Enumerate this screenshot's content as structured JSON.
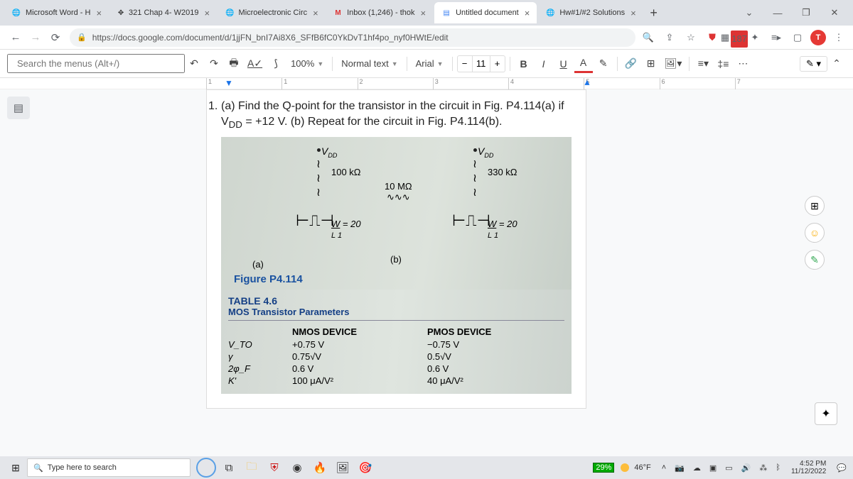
{
  "browser": {
    "tabs": [
      {
        "label": "Microsoft Word - H"
      },
      {
        "label": "321 Chap 4- W2019"
      },
      {
        "label": "Microelectronic Circ"
      },
      {
        "label": "Inbox (1,246) - thok"
      },
      {
        "label": "Untitled document"
      },
      {
        "label": "Hw#1/#2 Solutions"
      }
    ],
    "url": "https://docs.google.com/document/d/1jjFN_bnI7Ai8X6_SFfB6fC0YkDvT1hf4po_nyf0HWtE/edit",
    "ext_badge": "187",
    "avatar_letter": "T"
  },
  "docs": {
    "search_placeholder": "Search the menus (Alt+/)",
    "zoom": "100%",
    "style": "Normal text",
    "font": "Arial",
    "font_size": "11",
    "ruler": [
      "1",
      "1",
      "2",
      "3",
      "4",
      "5",
      "6",
      "7"
    ]
  },
  "content": {
    "problem_num": "1.",
    "problem_text_a": "(a) Find the Q-point for the transistor in the circuit in Fig. P4.114(a) if V",
    "problem_text_b": " = +12 V. (b) Repeat for the circuit in Fig. P4.114(b).",
    "vdd": "V",
    "vdd_sub": "DD",
    "res_a": "100 kΩ",
    "res_b": "330 kΩ",
    "ten_mohm": "10 MΩ",
    "wl": "W",
    "wl_eq": " = 20",
    "wl_den": "L       1",
    "label_a": "(a)",
    "label_b": "(b)",
    "fig_caption": "Figure P4.114",
    "table_title": "TABLE 4.6",
    "table_sub": "MOS Transistor Parameters",
    "col_nmos": "NMOS DEVICE",
    "col_pmos": "PMOS DEVICE",
    "rows": [
      {
        "p": "V_TO",
        "n": "+0.75 V",
        "m": "−0.75 V"
      },
      {
        "p": "γ",
        "n": "0.75√V",
        "m": "0.5√V"
      },
      {
        "p": "2φ_F",
        "n": "0.6 V",
        "m": "0.6 V"
      },
      {
        "p": "K'",
        "n": "100 μA/V²",
        "m": "40 μA/V²"
      }
    ]
  },
  "taskbar": {
    "search_placeholder": "Type here to search",
    "battery": "29%",
    "temp": "46°F",
    "time": "4:52 PM",
    "date": "11/12/2022"
  }
}
